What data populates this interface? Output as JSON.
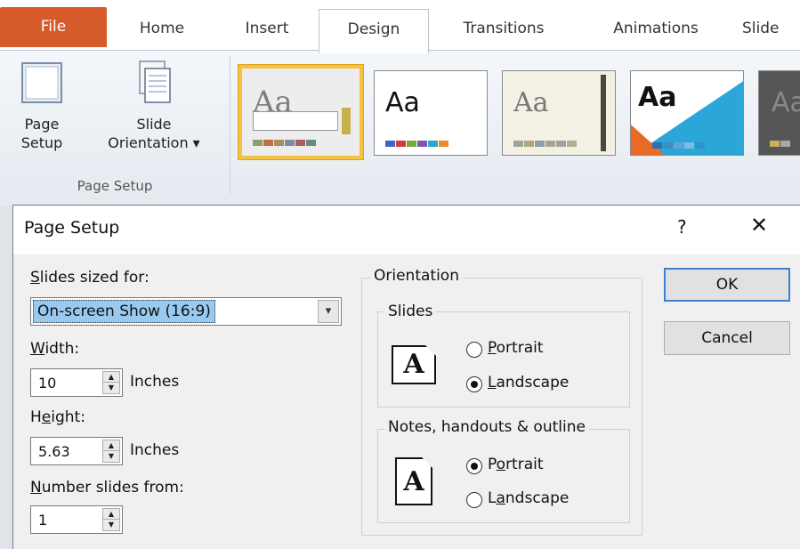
{
  "ribbon": {
    "tabs": [
      "File",
      "Home",
      "Insert",
      "Design",
      "Transitions",
      "Animations",
      "Slide"
    ],
    "page_setup_label": [
      "Page",
      "Setup"
    ],
    "slide_orientation_label": [
      "Slide",
      "Orientation ▾"
    ],
    "group_label": "Page Setup",
    "theme_sample_text": "Aa"
  },
  "dialog": {
    "title": "Page Setup",
    "help": "?",
    "close": "✕",
    "slides_sized_for": {
      "label_pre": "",
      "label_key": "S",
      "label_post": "lides sized for:",
      "value": "On-screen Show (16:9)"
    },
    "width": {
      "label_key": "W",
      "label_post": "idth:",
      "value": "10",
      "units": "Inches"
    },
    "height": {
      "label_pre": "H",
      "label_key": "e",
      "label_post": "ight:",
      "value": "5.63",
      "units": "Inches"
    },
    "number_from": {
      "label_key": "N",
      "label_post": "umber slides from:",
      "value": "1"
    },
    "orientation": {
      "title": "Orientation",
      "slides": {
        "title": "Slides",
        "portrait_pre": "",
        "portrait_key": "P",
        "portrait_post": "ortrait",
        "landscape_key": "L",
        "landscape_post": "andscape",
        "selected": "landscape"
      },
      "notes": {
        "title": "Notes, handouts & outline",
        "portrait_pre": "P",
        "portrait_key": "o",
        "portrait_post": "rtrait",
        "landscape_pre": "L",
        "landscape_key": "a",
        "landscape_post": "ndscape",
        "selected": "portrait"
      }
    },
    "ok": "OK",
    "cancel": "Cancel"
  }
}
